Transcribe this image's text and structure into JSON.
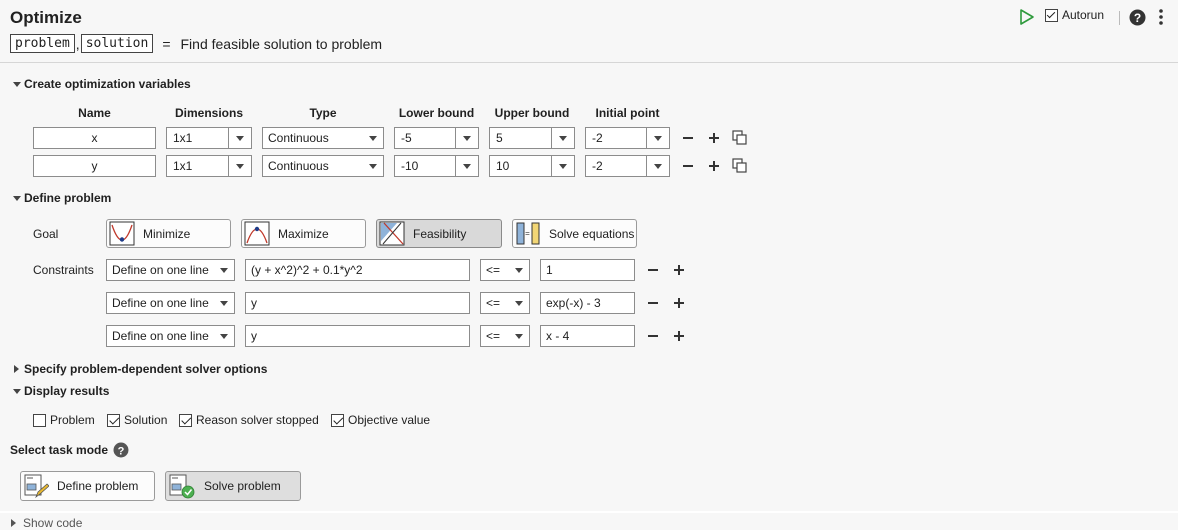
{
  "header": {
    "title": "Optimize",
    "autorun_label": "Autorun",
    "autorun_checked": true
  },
  "summary": {
    "output1": "problem",
    "output2": "solution",
    "equals": "=",
    "description": "Find feasible solution to problem"
  },
  "sections": {
    "create_vars": "Create optimization variables",
    "define_problem": "Define problem",
    "solver_options": "Specify problem-dependent solver options",
    "display_results": "Display results",
    "task_mode": "Select task mode",
    "show_code": "Show code"
  },
  "var_table": {
    "headers": [
      "Name",
      "Dimensions",
      "Type",
      "Lower bound",
      "Upper bound",
      "Initial point"
    ],
    "rows": [
      {
        "name": "x",
        "dims": "1x1",
        "type": "Continuous",
        "lower": "-5",
        "upper": "5",
        "init": "-2"
      },
      {
        "name": "y",
        "dims": "1x1",
        "type": "Continuous",
        "lower": "-10",
        "upper": "10",
        "init": "-2"
      }
    ]
  },
  "goal": {
    "label": "Goal",
    "buttons": [
      "Minimize",
      "Maximize",
      "Feasibility",
      "Solve equations"
    ],
    "selected": "Feasibility"
  },
  "constraints": {
    "label": "Constraints",
    "rows": [
      {
        "mode": "Define on one line",
        "lhs": "(y + x^2)^2 + 0.1*y^2",
        "op": "<=",
        "rhs": "1"
      },
      {
        "mode": "Define on one line",
        "lhs": "y",
        "op": "<=",
        "rhs": "exp(-x) - 3"
      },
      {
        "mode": "Define on one line",
        "lhs": "y",
        "op": "<=",
        "rhs": "x - 4"
      }
    ]
  },
  "display": {
    "options": [
      {
        "label": "Problem",
        "checked": false
      },
      {
        "label": "Solution",
        "checked": true
      },
      {
        "label": "Reason solver stopped",
        "checked": true
      },
      {
        "label": "Objective value",
        "checked": true
      }
    ]
  },
  "task": {
    "buttons": [
      "Define problem",
      "Solve problem"
    ],
    "selected": "Solve problem"
  },
  "icons": {
    "run": "run-icon",
    "help": "help-icon",
    "more": "more-options-icon"
  },
  "colors": {
    "run_green": "#2e9a3c",
    "accent_red": "#c0392b"
  }
}
